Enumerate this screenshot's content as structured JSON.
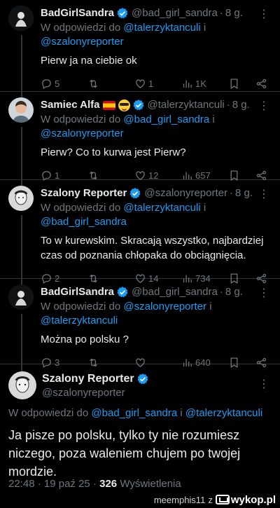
{
  "tweets": [
    {
      "name": "BadGirlSandra",
      "handle": "@bad_girl_sandra",
      "dot": "·",
      "time": "8 g.",
      "reply_prefix": "W odpowiedzi do",
      "mention1": "@talerzyktanculi",
      "conj": "i",
      "mention2": "@szalonyreporter",
      "text": "Pierw ja na ciebie ok",
      "replies": "5",
      "retweets": "",
      "likes": "1",
      "views": "1K"
    },
    {
      "name": "Samiec Alfa",
      "handle": "@talerzyktanculi",
      "dot": "·",
      "time": "8 g.",
      "reply_prefix": "W odpowiedzi do",
      "mention1": "@bad_girl_sandra",
      "conj": "i",
      "mention2": "@szalonyreporter",
      "text": "Pierw? Co to kurwa jest Pierw?",
      "replies": "1",
      "retweets": "",
      "likes": "12",
      "views": "657"
    },
    {
      "name": "Szalony Reporter",
      "handle": "@szalonyreporter",
      "dot": "·",
      "time": "8 g.",
      "reply_prefix": "W odpowiedzi do",
      "mention1": "@talerzyktanculi",
      "conj": "i",
      "mention2": "@bad_girl_sandra",
      "text": "To w kurewskim. Skracają wszystko, najbardziej czas od poznania chłopaka do obciągnięcia.",
      "replies": "2",
      "retweets": "",
      "likes": "14",
      "views": "734"
    },
    {
      "name": "BadGirlSandra",
      "handle": "@bad_girl_sandra",
      "dot": "·",
      "time": "8 g.",
      "reply_prefix": "W odpowiedzi do",
      "mention1": "@szalonyreporter",
      "conj": "i",
      "mention2": "@talerzyktanculi",
      "text": "Można po polsku ?",
      "replies": "3",
      "retweets": "",
      "likes": "",
      "views": "640"
    }
  ],
  "main": {
    "name": "Szalony Reporter",
    "handle": "@szalonyreporter",
    "reply_prefix": "W odpowiedzi do",
    "mention1": "@bad_girl_sandra",
    "conj": "i",
    "mention2": "@talerzyktanculi",
    "text": "Ja pisze po polsku, tylko ty nie rozumiesz niczego, poza waleniem chujem po twojej mordzie.",
    "time": "22:48",
    "date": "19 paź 25",
    "views_count": "326",
    "views_label": "Wyświetlenia"
  },
  "footer": {
    "user": "meemphis11",
    "z": "z",
    "site": "wykop.pl"
  },
  "colors": {
    "background": "#000000",
    "text": "#e7e9ea",
    "muted": "#71767b",
    "accent": "#1d9bf0",
    "divider": "#2f3336"
  },
  "icons": [
    "verified-badge-icon",
    "more-icon",
    "reply-icon",
    "retweet-icon",
    "like-icon",
    "views-icon",
    "bookmark-icon",
    "share-icon"
  ]
}
